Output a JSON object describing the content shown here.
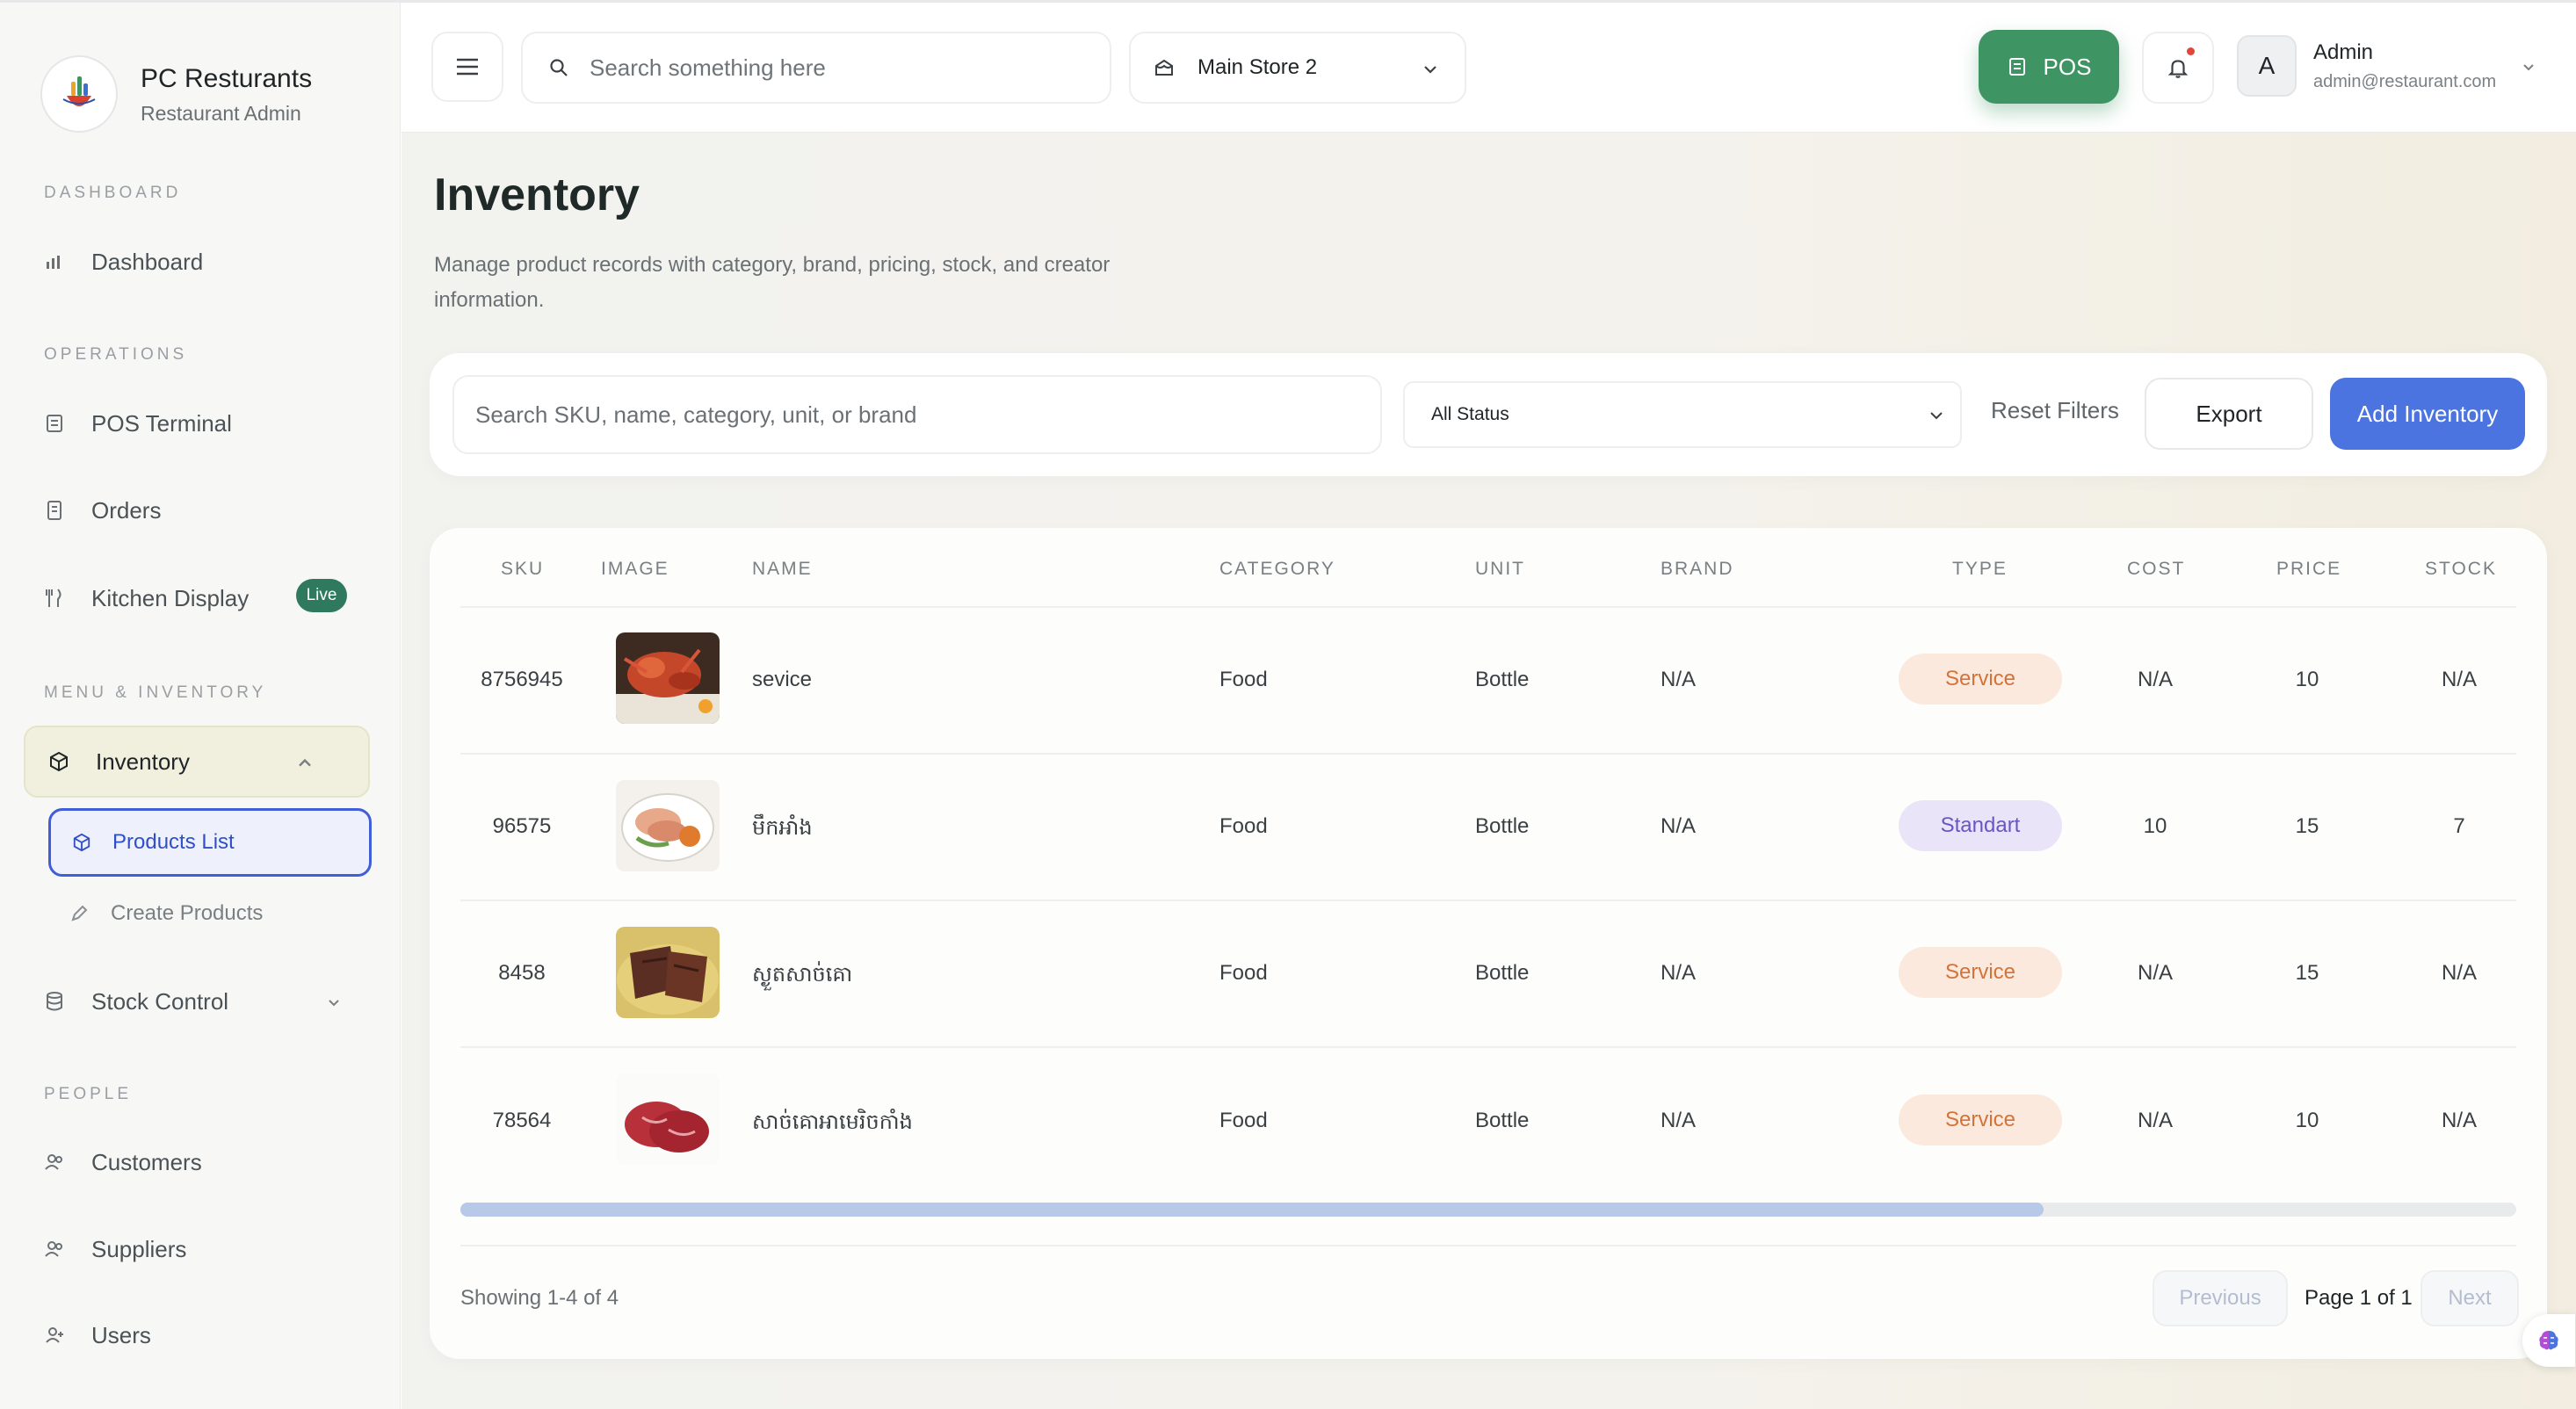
{
  "brand": {
    "name": "PC Resturants",
    "subtitle": "Restaurant Admin"
  },
  "sidebar": {
    "sections": {
      "dashboard": "DASHBOARD",
      "operations": "OPERATIONS",
      "menu_inventory": "MENU & INVENTORY",
      "people": "PEOPLE"
    },
    "items": {
      "dashboard": "Dashboard",
      "pos_terminal": "POS Terminal",
      "orders": "Orders",
      "kitchen_display": "Kitchen Display",
      "kitchen_badge": "Live",
      "inventory": "Inventory",
      "products_list": "Products List",
      "create_products": "Create Products",
      "stock_control": "Stock Control",
      "customers": "Customers",
      "suppliers": "Suppliers",
      "users": "Users"
    }
  },
  "topbar": {
    "search_placeholder": "Search something here",
    "store": "Main Store 2",
    "pos_label": "POS",
    "user_initial": "A",
    "user_name": "Admin",
    "user_email": "admin@restaurant.com"
  },
  "page": {
    "title": "Inventory",
    "description": "Manage product records with category, brand, pricing, stock, and creator information."
  },
  "filters": {
    "search_placeholder": "Search SKU, name, category, unit, or brand",
    "status": "All Status",
    "reset_label": "Reset Filters",
    "export_label": "Export",
    "add_label": "Add Inventory"
  },
  "table": {
    "headers": {
      "sku": "SKU",
      "image": "IMAGE",
      "name": "NAME",
      "category": "CATEGORY",
      "unit": "UNIT",
      "brand": "BRAND",
      "type": "TYPE",
      "cost": "COST",
      "price": "PRICE",
      "stock": "STOCK"
    },
    "rows": [
      {
        "sku": "8756945",
        "name": "sevice",
        "category": "Food",
        "unit": "Bottle",
        "brand": "N/A",
        "type": "Service",
        "cost": "N/A",
        "price": "10",
        "stock": "N/A"
      },
      {
        "sku": "96575",
        "name": "មឹកអាំង",
        "category": "Food",
        "unit": "Bottle",
        "brand": "N/A",
        "type": "Standart",
        "cost": "10",
        "price": "15",
        "stock": "7"
      },
      {
        "sku": "8458",
        "name": "ស្ងួតសាច់គោ",
        "category": "Food",
        "unit": "Bottle",
        "brand": "N/A",
        "type": "Service",
        "cost": "N/A",
        "price": "15",
        "stock": "N/A"
      },
      {
        "sku": "78564",
        "name": "សាច់គោអាមេរិចកាំង",
        "category": "Food",
        "unit": "Bottle",
        "brand": "N/A",
        "type": "Service",
        "cost": "N/A",
        "price": "10",
        "stock": "N/A"
      }
    ],
    "horizontal_scroll_visible_fraction": 0.77
  },
  "pagination": {
    "showing": "Showing 1-4 of 4",
    "previous": "Previous",
    "page": "Page 1 of 1",
    "next": "Next"
  },
  "colors": {
    "primary": "#4c74e0",
    "pos_green": "#3f9464",
    "live_badge": "#2f7a5e",
    "service_pill_bg": "#fbe9dd",
    "service_pill_text": "#d2733a",
    "standart_pill_bg": "#e9e4f7",
    "standart_pill_text": "#6a55c7"
  }
}
